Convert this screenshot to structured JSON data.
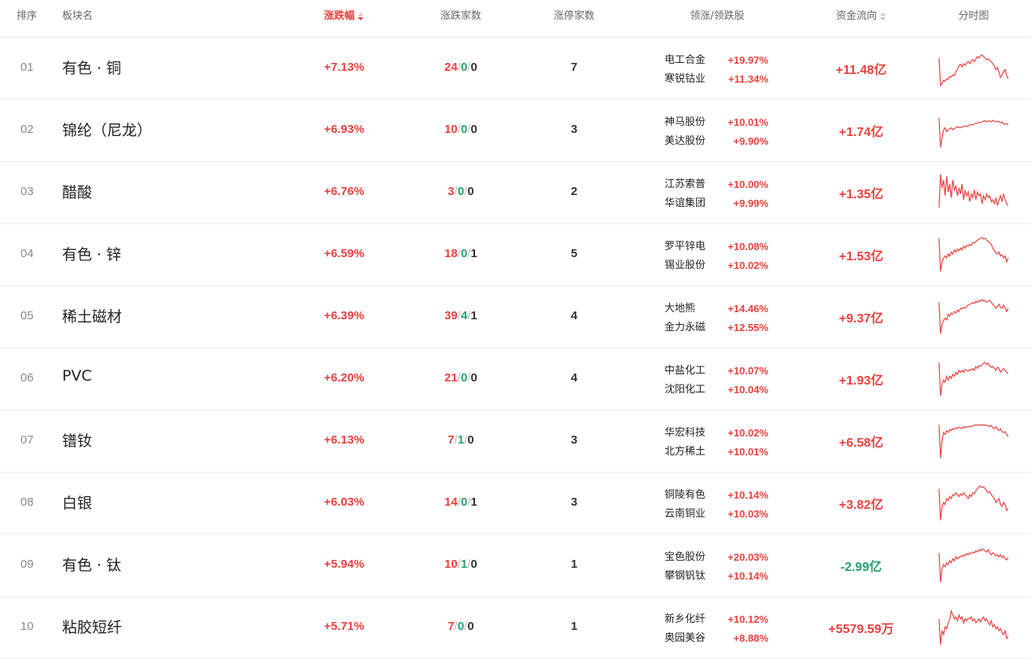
{
  "colors": {
    "up": "#e8413e",
    "down": "#22a06b",
    "neutral": "#333333"
  },
  "header": {
    "rank": "排序",
    "name": "板块名",
    "pct": "涨跌幅",
    "updown": "涨跌家数",
    "limit": "涨停家数",
    "leaders": "领涨/领跌股",
    "flow": "资金流向",
    "spark": "分时图"
  },
  "rows": [
    {
      "rank": "01",
      "name": "有色 · 铜",
      "pct": "+7.13%",
      "up": "24",
      "flat": "0",
      "down": "0",
      "limit": "7",
      "leaders": [
        {
          "name": "电工合金",
          "pct": "+19.97%"
        },
        {
          "name": "寒锐钴业",
          "pct": "+11.34%"
        }
      ],
      "flow": "+11.48亿",
      "flow_dir": "up",
      "spark": [
        0.25,
        0.95,
        0.9,
        0.82,
        0.85,
        0.78,
        0.8,
        0.72,
        0.74,
        0.68,
        0.7,
        0.6,
        0.55,
        0.45,
        0.42,
        0.48,
        0.4,
        0.44,
        0.38,
        0.35,
        0.4,
        0.32,
        0.3,
        0.35,
        0.28,
        0.22,
        0.25,
        0.2,
        0.18,
        0.22,
        0.25,
        0.3,
        0.28,
        0.32,
        0.35,
        0.4,
        0.45,
        0.55,
        0.5,
        0.62,
        0.75,
        0.68,
        0.6,
        0.55,
        0.7,
        0.78
      ]
    },
    {
      "rank": "02",
      "name": "锦纶（尼龙）",
      "pct": "+6.93%",
      "up": "10",
      "flat": "0",
      "down": "0",
      "limit": "3",
      "leaders": [
        {
          "name": "神马股份",
          "pct": "+10.01%"
        },
        {
          "name": "美达股份",
          "pct": "+9.90%"
        }
      ],
      "flow": "+1.74亿",
      "flow_dir": "up",
      "spark": [
        0.2,
        0.95,
        0.7,
        0.5,
        0.45,
        0.55,
        0.5,
        0.48,
        0.45,
        0.5,
        0.47,
        0.45,
        0.42,
        0.44,
        0.45,
        0.43,
        0.42,
        0.4,
        0.42,
        0.4,
        0.38,
        0.36,
        0.38,
        0.35,
        0.33,
        0.34,
        0.3,
        0.32,
        0.3,
        0.28,
        0.27,
        0.3,
        0.27,
        0.28,
        0.3,
        0.26,
        0.28,
        0.3,
        0.28,
        0.3,
        0.32,
        0.3,
        0.35,
        0.36,
        0.34,
        0.38
      ]
    },
    {
      "rank": "03",
      "name": "醋酸",
      "pct": "+6.76%",
      "up": "3",
      "flat": "0",
      "down": "0",
      "limit": "2",
      "leaders": [
        {
          "name": "江苏索普",
          "pct": "+10.00%"
        },
        {
          "name": "华谊集团",
          "pct": "+9.99%"
        }
      ],
      "flow": "+1.35亿",
      "flow_dir": "up",
      "spark": [
        0.9,
        0.05,
        0.4,
        0.2,
        0.6,
        0.1,
        0.5,
        0.3,
        0.65,
        0.2,
        0.45,
        0.35,
        0.6,
        0.4,
        0.55,
        0.3,
        0.7,
        0.45,
        0.6,
        0.5,
        0.75,
        0.55,
        0.65,
        0.45,
        0.7,
        0.5,
        0.6,
        0.55,
        0.8,
        0.6,
        0.7,
        0.55,
        0.65,
        0.6,
        0.75,
        0.7,
        0.8,
        0.65,
        0.85,
        0.7,
        0.6,
        0.75,
        0.55,
        0.7,
        0.8,
        0.85
      ]
    },
    {
      "rank": "04",
      "name": "有色 · 锌",
      "pct": "+6.59%",
      "up": "18",
      "flat": "0",
      "down": "1",
      "limit": "5",
      "leaders": [
        {
          "name": "罗平锌电",
          "pct": "+10.08%"
        },
        {
          "name": "锡业股份",
          "pct": "+10.02%"
        }
      ],
      "flow": "+1.53亿",
      "flow_dir": "up",
      "spark": [
        0.1,
        0.95,
        0.7,
        0.6,
        0.55,
        0.6,
        0.5,
        0.55,
        0.45,
        0.5,
        0.4,
        0.45,
        0.38,
        0.42,
        0.35,
        0.4,
        0.3,
        0.35,
        0.28,
        0.3,
        0.25,
        0.28,
        0.2,
        0.22,
        0.18,
        0.15,
        0.12,
        0.1,
        0.08,
        0.12,
        0.1,
        0.15,
        0.18,
        0.22,
        0.25,
        0.35,
        0.4,
        0.48,
        0.5,
        0.45,
        0.55,
        0.52,
        0.6,
        0.55,
        0.7,
        0.6
      ]
    },
    {
      "rank": "05",
      "name": "稀土磁材",
      "pct": "+6.39%",
      "up": "39",
      "flat": "4",
      "down": "1",
      "limit": "4",
      "leaders": [
        {
          "name": "大地熊",
          "pct": "+14.46%"
        },
        {
          "name": "金力永磁",
          "pct": "+12.55%"
        }
      ],
      "flow": "+9.37亿",
      "flow_dir": "up",
      "spark": [
        0.15,
        0.95,
        0.7,
        0.6,
        0.55,
        0.6,
        0.45,
        0.5,
        0.42,
        0.45,
        0.38,
        0.42,
        0.35,
        0.38,
        0.3,
        0.32,
        0.28,
        0.3,
        0.25,
        0.22,
        0.2,
        0.18,
        0.15,
        0.18,
        0.12,
        0.15,
        0.1,
        0.12,
        0.08,
        0.12,
        0.1,
        0.14,
        0.12,
        0.1,
        0.15,
        0.2,
        0.25,
        0.3,
        0.25,
        0.2,
        0.28,
        0.3,
        0.22,
        0.3,
        0.38,
        0.3
      ]
    },
    {
      "rank": "06",
      "name": "PVC",
      "pct": "+6.20%",
      "up": "21",
      "flat": "0",
      "down": "0",
      "limit": "4",
      "leaders": [
        {
          "name": "中盐化工",
          "pct": "+10.07%"
        },
        {
          "name": "沈阳化工",
          "pct": "+10.04%"
        }
      ],
      "flow": "+1.93亿",
      "flow_dir": "up",
      "spark": [
        0.1,
        0.95,
        0.65,
        0.55,
        0.6,
        0.45,
        0.55,
        0.45,
        0.5,
        0.4,
        0.45,
        0.35,
        0.4,
        0.3,
        0.35,
        0.3,
        0.35,
        0.28,
        0.3,
        0.32,
        0.28,
        0.3,
        0.25,
        0.3,
        0.2,
        0.25,
        0.18,
        0.2,
        0.15,
        0.12,
        0.1,
        0.15,
        0.12,
        0.18,
        0.22,
        0.2,
        0.25,
        0.3,
        0.22,
        0.25,
        0.35,
        0.3,
        0.25,
        0.3,
        0.35,
        0.38
      ]
    },
    {
      "rank": "07",
      "name": "镨钕",
      "pct": "+6.13%",
      "up": "7",
      "flat": "1",
      "down": "0",
      "limit": "3",
      "leaders": [
        {
          "name": "华宏科技",
          "pct": "+10.02%"
        },
        {
          "name": "北方稀土",
          "pct": "+10.01%"
        }
      ],
      "flow": "+6.58亿",
      "flow_dir": "up",
      "spark": [
        0.1,
        0.95,
        0.5,
        0.3,
        0.35,
        0.25,
        0.3,
        0.22,
        0.25,
        0.2,
        0.22,
        0.18,
        0.2,
        0.16,
        0.18,
        0.2,
        0.15,
        0.18,
        0.15,
        0.16,
        0.14,
        0.15,
        0.13,
        0.12,
        0.1,
        0.12,
        0.1,
        0.11,
        0.1,
        0.12,
        0.1,
        0.12,
        0.13,
        0.15,
        0.12,
        0.18,
        0.2,
        0.15,
        0.22,
        0.25,
        0.2,
        0.28,
        0.3,
        0.28,
        0.35,
        0.4
      ]
    },
    {
      "rank": "08",
      "name": "白银",
      "pct": "+6.03%",
      "up": "14",
      "flat": "0",
      "down": "1",
      "limit": "3",
      "leaders": [
        {
          "name": "铜陵有色",
          "pct": "+10.14%"
        },
        {
          "name": "云南铜业",
          "pct": "+10.03%"
        }
      ],
      "flow": "+3.82亿",
      "flow_dir": "up",
      "spark": [
        0.15,
        0.95,
        0.6,
        0.5,
        0.55,
        0.4,
        0.45,
        0.35,
        0.4,
        0.3,
        0.32,
        0.25,
        0.3,
        0.35,
        0.28,
        0.32,
        0.25,
        0.3,
        0.35,
        0.4,
        0.3,
        0.35,
        0.25,
        0.28,
        0.2,
        0.15,
        0.1,
        0.08,
        0.12,
        0.1,
        0.15,
        0.2,
        0.25,
        0.22,
        0.3,
        0.35,
        0.4,
        0.5,
        0.45,
        0.4,
        0.55,
        0.6,
        0.5,
        0.55,
        0.7,
        0.65
      ]
    },
    {
      "rank": "09",
      "name": "有色 · 钛",
      "pct": "+5.94%",
      "up": "10",
      "flat": "1",
      "down": "0",
      "limit": "1",
      "leaders": [
        {
          "name": "宝色股份",
          "pct": "+20.03%"
        },
        {
          "name": "攀钢钒钛",
          "pct": "+10.14%"
        }
      ],
      "flow": "-2.99亿",
      "flow_dir": "down",
      "spark": [
        0.2,
        0.95,
        0.6,
        0.5,
        0.55,
        0.45,
        0.5,
        0.4,
        0.45,
        0.35,
        0.4,
        0.3,
        0.35,
        0.32,
        0.28,
        0.3,
        0.25,
        0.28,
        0.22,
        0.25,
        0.2,
        0.22,
        0.18,
        0.2,
        0.15,
        0.18,
        0.12,
        0.15,
        0.1,
        0.12,
        0.15,
        0.18,
        0.12,
        0.2,
        0.25,
        0.2,
        0.22,
        0.28,
        0.25,
        0.3,
        0.25,
        0.32,
        0.28,
        0.35,
        0.38,
        0.32
      ]
    },
    {
      "rank": "10",
      "name": "粘胶短纤",
      "pct": "+5.71%",
      "up": "7",
      "flat": "0",
      "down": "0",
      "limit": "1",
      "leaders": [
        {
          "name": "新乡化纤",
          "pct": "+10.12%"
        },
        {
          "name": "奥园美谷",
          "pct": "+8.88%"
        }
      ],
      "flow": "+5579.59万",
      "flow_dir": "up",
      "spark": [
        0.3,
        0.95,
        0.6,
        0.7,
        0.5,
        0.55,
        0.4,
        0.3,
        0.1,
        0.2,
        0.3,
        0.25,
        0.35,
        0.2,
        0.3,
        0.25,
        0.4,
        0.3,
        0.35,
        0.28,
        0.3,
        0.25,
        0.35,
        0.3,
        0.4,
        0.35,
        0.3,
        0.38,
        0.3,
        0.25,
        0.35,
        0.3,
        0.4,
        0.45,
        0.35,
        0.5,
        0.45,
        0.55,
        0.5,
        0.6,
        0.55,
        0.65,
        0.7,
        0.6,
        0.8,
        0.75
      ]
    }
  ]
}
